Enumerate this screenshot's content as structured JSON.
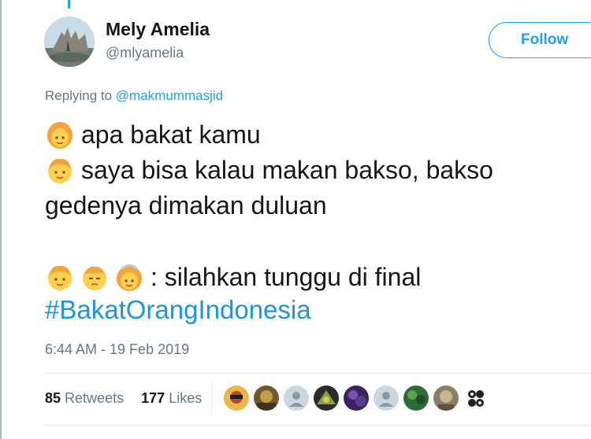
{
  "author": {
    "name": "Mely Amelia",
    "handle": "@mlyamelia"
  },
  "follow_button": {
    "label": "Follow"
  },
  "reply_context": {
    "prefix": "Replying to",
    "mention": "@makmummasjid"
  },
  "tweet": {
    "line1": "apa bakat kamu",
    "line2": "saya bisa kalau makan bakso,  bakso",
    "line3": "gedenya dimakan duluan",
    "line4": ": silahkan tunggu di final",
    "hashtag": "#BakatOrangIndonesia"
  },
  "timestamp": "6:44 AM - 19 Feb 2019",
  "stats": {
    "retweets_count": "85",
    "retweets_label": "Retweets",
    "likes_count": "177",
    "likes_label": "Likes"
  },
  "colors": {
    "accent": "#1da1f2",
    "secondary_text": "#657786",
    "primary_text": "#14171a"
  }
}
